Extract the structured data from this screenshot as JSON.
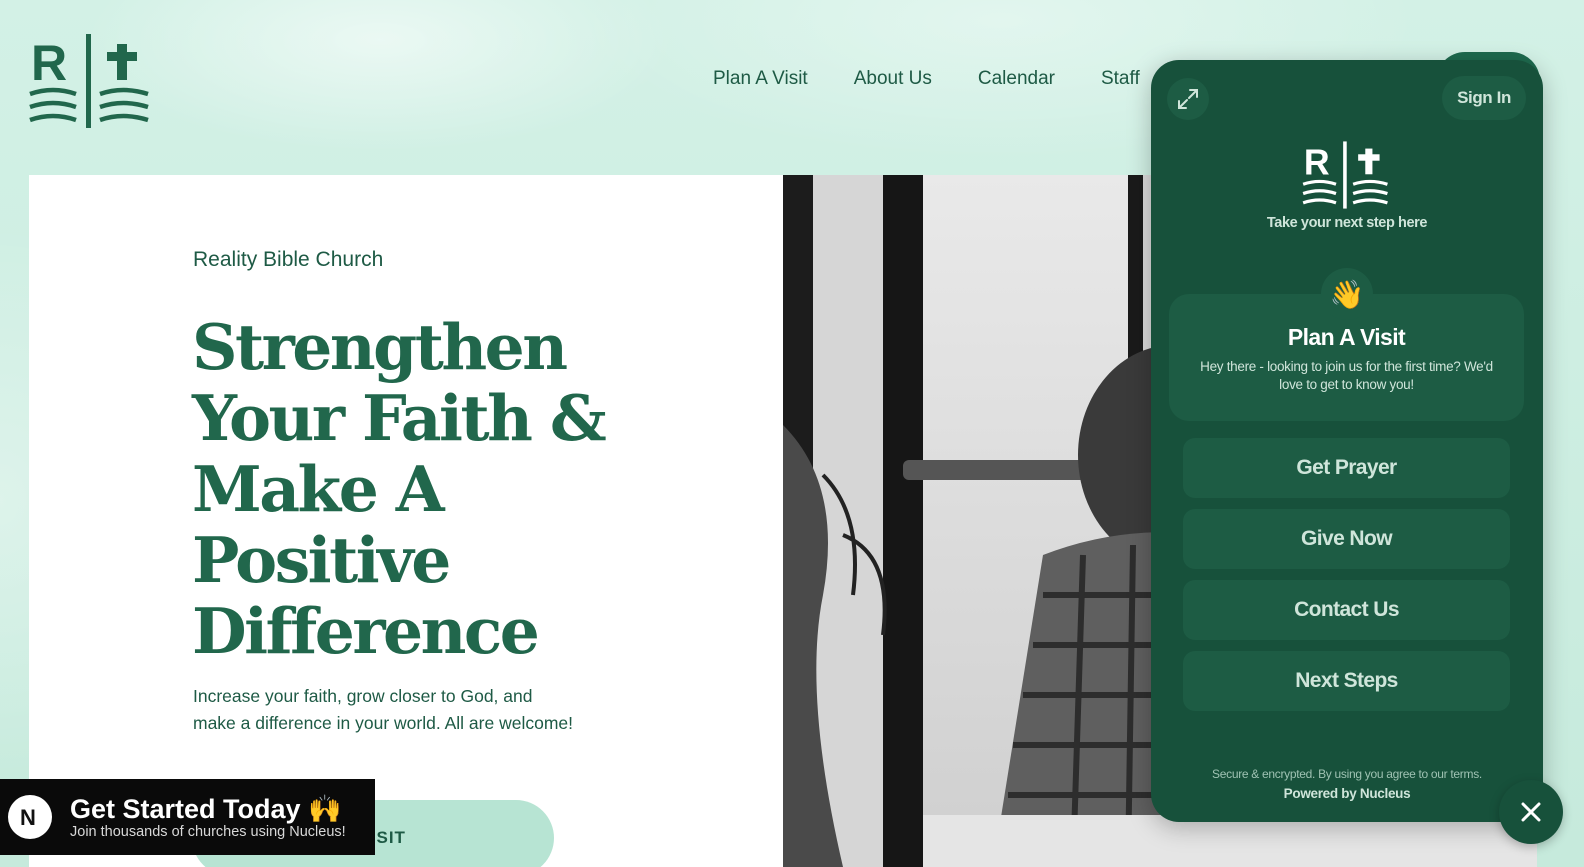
{
  "header": {
    "logo_letter": "R",
    "nav": [
      "Plan A Visit",
      "About Us",
      "Calendar",
      "Staff"
    ]
  },
  "hero": {
    "eyebrow": "Reality Bible Church",
    "headline": "Strengthen Your Faith & Make A Positive Difference",
    "subtext": "Increase your faith, grow closer to God, and make a difference in your world. All are welcome!",
    "cta_label": "A VISIT"
  },
  "promo": {
    "title": "Get Started Today 🙌",
    "subtitle": "Join thousands of churches using Nucleus!",
    "logo_letter": "N"
  },
  "widget": {
    "sign_in": "Sign In",
    "tagline": "Take your next step here",
    "featured": {
      "emoji": "👋",
      "title": "Plan A Visit",
      "description": "Hey there - looking to join us for the first time? We'd love to get to know you!"
    },
    "buttons": [
      "Get Prayer",
      "Give Now",
      "Contact Us",
      "Next Steps"
    ],
    "footer": "Secure & encrypted. By using you agree to our terms.",
    "powered_by": "Powered by Nucleus"
  },
  "colors": {
    "brand_green": "#21674c",
    "widget_bg": "#17513b",
    "page_bg": "#cfeee2"
  }
}
